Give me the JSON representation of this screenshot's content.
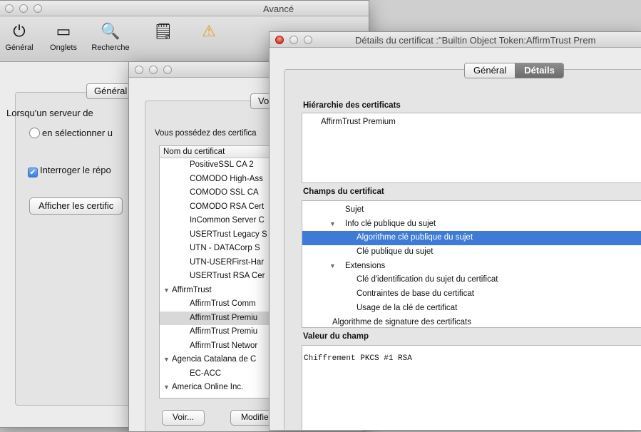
{
  "win1": {
    "title": "Avancé",
    "toolbar": [
      {
        "label": "Général",
        "icon": "switch-icon",
        "glyph": "⏻"
      },
      {
        "label": "Onglets",
        "icon": "tabs-icon",
        "glyph": "▭"
      },
      {
        "label": "Recherche",
        "icon": "magnifier-icon",
        "glyph": "🔍"
      },
      {
        "label": "",
        "icon": "document-icon",
        "glyph": "🗒"
      },
      {
        "label": "",
        "icon": "warning-icon",
        "glyph": "⚠"
      }
    ],
    "pane_tab": "Général",
    "server_text": "Lorsqu'un serveur de",
    "radio_label": "en sélectionner u",
    "checkbox_label": "Interroger le répo",
    "checkbox_mark": "✔",
    "show_certs_button": "Afficher les certific"
  },
  "win2": {
    "segment_label": "Vo",
    "intro_text": "Vous possédez des certifica",
    "column_header": "Nom du certificat",
    "rows": [
      {
        "text": "PositiveSSL CA 2",
        "level": 2,
        "toggle": false,
        "selected": false
      },
      {
        "text": "COMODO High-Ass",
        "level": 2,
        "toggle": false,
        "selected": false
      },
      {
        "text": "COMODO SSL CA",
        "level": 2,
        "toggle": false,
        "selected": false
      },
      {
        "text": "COMODO RSA Cert",
        "level": 2,
        "toggle": false,
        "selected": false
      },
      {
        "text": "InCommon Server C",
        "level": 2,
        "toggle": false,
        "selected": false
      },
      {
        "text": "USERTrust Legacy S",
        "level": 2,
        "toggle": false,
        "selected": false
      },
      {
        "text": "UTN - DATACorp S",
        "level": 2,
        "toggle": false,
        "selected": false
      },
      {
        "text": "UTN-USERFirst-Har",
        "level": 2,
        "toggle": false,
        "selected": false
      },
      {
        "text": "USERTrust RSA Cer",
        "level": 2,
        "toggle": false,
        "selected": false
      },
      {
        "text": "AffirmTrust",
        "level": 1,
        "toggle": true,
        "selected": false
      },
      {
        "text": "AffirmTrust Comm",
        "level": 2,
        "toggle": false,
        "selected": false
      },
      {
        "text": "AffirmTrust Premiu",
        "level": 2,
        "toggle": false,
        "selected": true
      },
      {
        "text": "AffirmTrust Premiu",
        "level": 2,
        "toggle": false,
        "selected": false
      },
      {
        "text": "AffirmTrust Networ",
        "level": 2,
        "toggle": false,
        "selected": false
      },
      {
        "text": "Agencia Catalana de C",
        "level": 1,
        "toggle": true,
        "selected": false
      },
      {
        "text": "EC-ACC",
        "level": 2,
        "toggle": false,
        "selected": false
      },
      {
        "text": "America Online Inc.",
        "level": 1,
        "toggle": true,
        "selected": false
      }
    ],
    "view_button": "Voir...",
    "modify_button": "Modifie"
  },
  "win3": {
    "title": "Détails du certificat :\"Builtin Object Token:AffirmTrust Prem",
    "tabs": [
      {
        "label": "Général",
        "active": false
      },
      {
        "label": "Détails",
        "active": true
      }
    ],
    "hierarchy_title": "Hiérarchie des certificats",
    "hierarchy_item": "AffirmTrust Premium",
    "fields_title": "Champs du certificat",
    "fields": [
      {
        "text": "Sujet",
        "level": 1,
        "toggle": false,
        "selected": false
      },
      {
        "text": "Info clé publique du sujet",
        "level": 1,
        "toggle": true,
        "selected": false
      },
      {
        "text": "Algorithme clé publique du sujet",
        "level": 2,
        "toggle": false,
        "selected": true
      },
      {
        "text": "Clé publique du sujet",
        "level": 2,
        "toggle": false,
        "selected": false
      },
      {
        "text": "Extensions",
        "level": 1,
        "toggle": true,
        "selected": false
      },
      {
        "text": "Clé d'identification du sujet du certificat",
        "level": 2,
        "toggle": false,
        "selected": false
      },
      {
        "text": "Contraintes de base du certificat",
        "level": 2,
        "toggle": false,
        "selected": false
      },
      {
        "text": "Usage de la clé de certificat",
        "level": 2,
        "toggle": false,
        "selected": false
      },
      {
        "text": "Algorithme de signature des certificats",
        "level": 0,
        "toggle": false,
        "selected": false
      }
    ],
    "value_title": "Valeur du champ",
    "value_text": "Chiffrement PKCS #1 RSA"
  },
  "colors": {
    "selection": "#3d7bd6",
    "close_red": "#d6332b"
  }
}
